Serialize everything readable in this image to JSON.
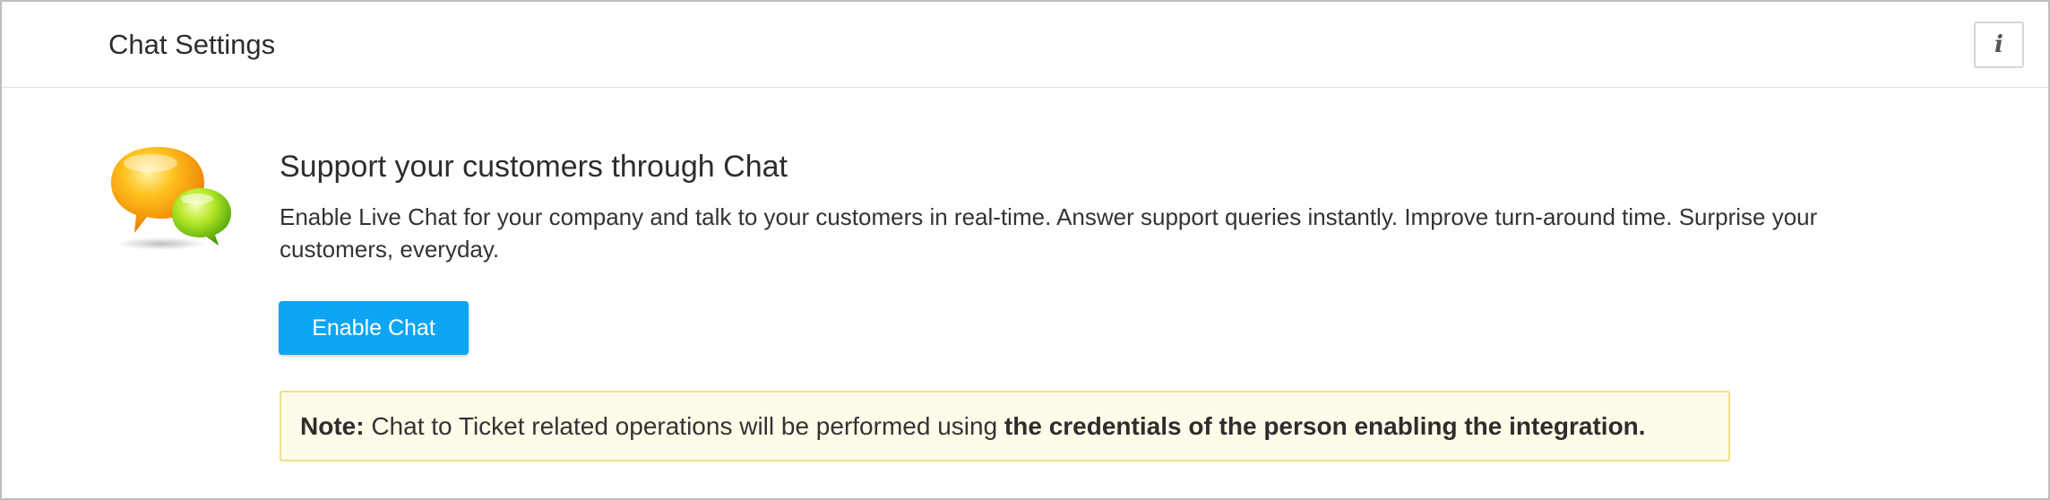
{
  "header": {
    "title": "Chat Settings",
    "info_label": "i"
  },
  "main": {
    "icon": "chat-bubbles-icon",
    "heading": "Support your customers through Chat",
    "description": "Enable Live Chat for your company and talk to your customers in real-time. Answer support queries instantly. Improve turn-around time. Surprise your customers, everyday.",
    "enable_button_label": "Enable Chat"
  },
  "note": {
    "label": "Note:",
    "text": " Chat to Ticket related operations will be performed using ",
    "emphasis": "the credentials of the person enabling the integration."
  },
  "colors": {
    "primary_button": "#0ea5f5",
    "note_background": "#fefbe8",
    "note_border": "#f0df8a"
  }
}
